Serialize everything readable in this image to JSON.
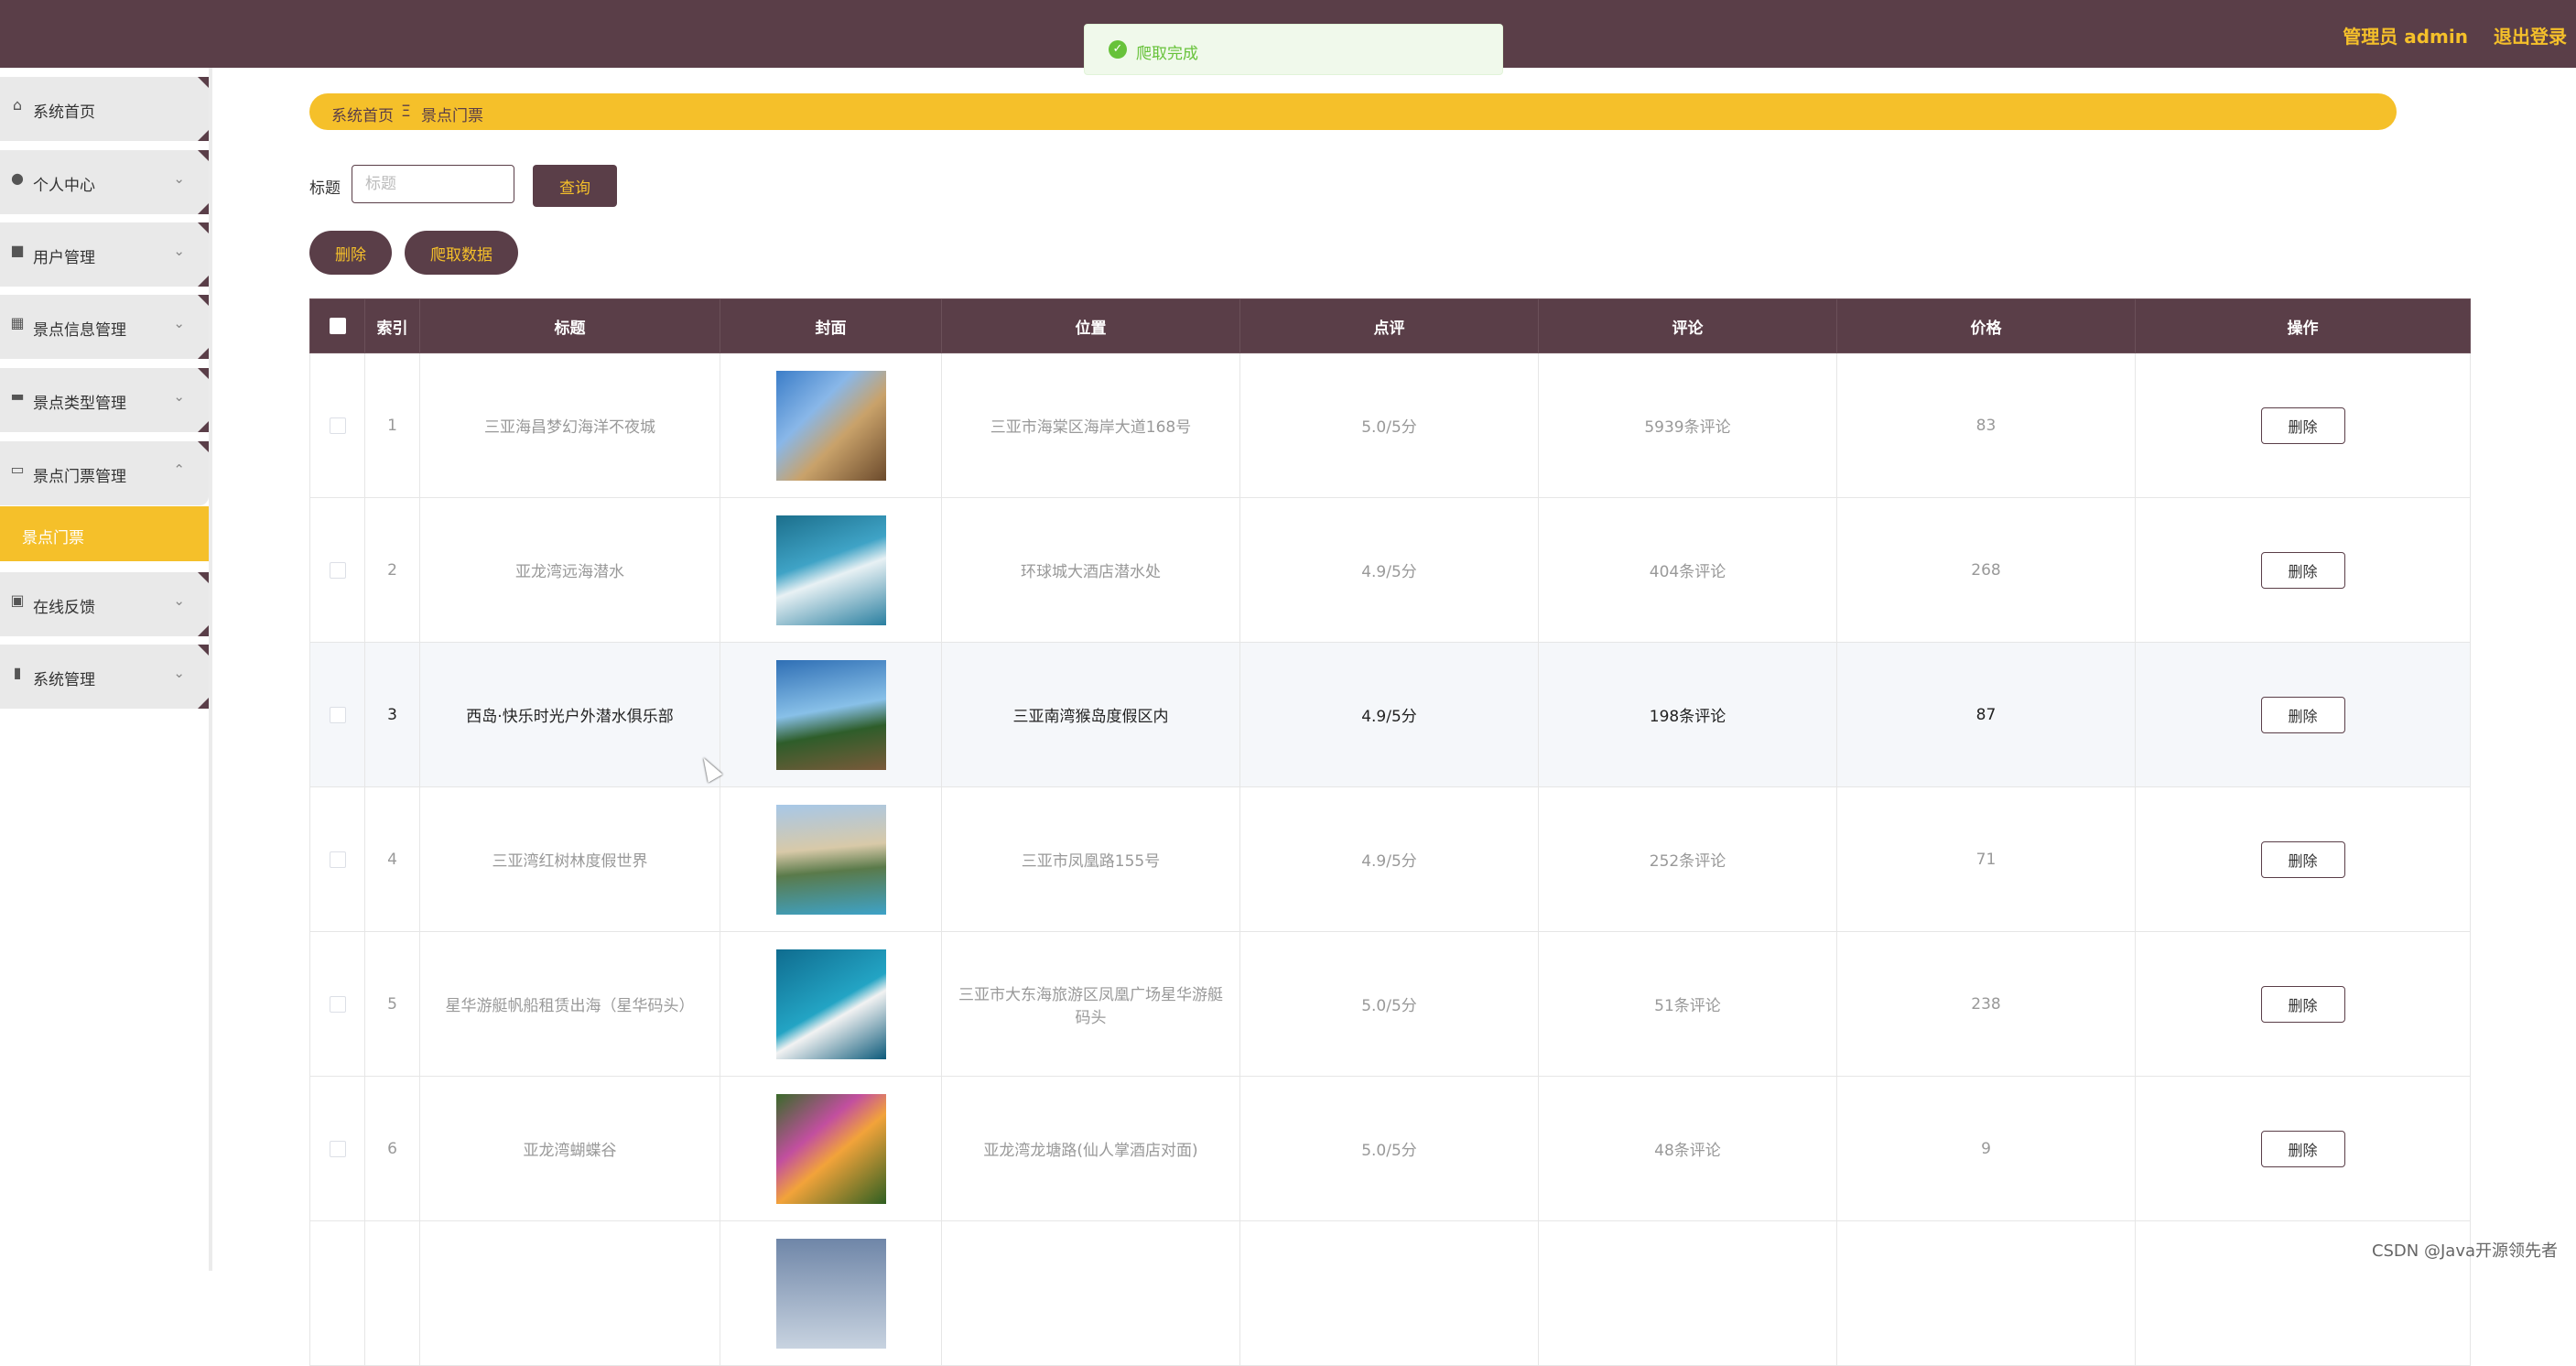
{
  "header": {
    "admin_label": "管理员 admin",
    "logout_label": "退出登录"
  },
  "toast": {
    "message": "爬取完成"
  },
  "sidebar": {
    "items": [
      {
        "label": "系统首页",
        "icon": "home-icon"
      },
      {
        "label": "个人中心",
        "icon": "user-icon"
      },
      {
        "label": "用户管理",
        "icon": "users-icon"
      },
      {
        "label": "景点信息管理",
        "icon": "grid-icon"
      },
      {
        "label": "景点类型管理",
        "icon": "briefcase-icon"
      },
      {
        "label": "景点门票管理",
        "icon": "ticket-icon"
      },
      {
        "label": "在线反馈",
        "icon": "clipboard-icon"
      },
      {
        "label": "系统管理",
        "icon": "bar-chart-icon"
      }
    ],
    "active_submenu": "景点门票"
  },
  "breadcrumb": {
    "home": "系统首页",
    "separator": "Ξ",
    "current": "景点门票"
  },
  "search": {
    "label": "标题",
    "placeholder": "标题",
    "query_button": "查询"
  },
  "actions": {
    "delete_label": "删除",
    "crawl_label": "爬取数据"
  },
  "table": {
    "headers": [
      "索引",
      "标题",
      "封面",
      "位置",
      "点评",
      "评论",
      "价格",
      "操作"
    ],
    "row_delete_label": "删除",
    "rows": [
      {
        "index": "1",
        "title": "三亚海昌梦幻海洋不夜城",
        "location": "三亚市海棠区海岸大道168号",
        "rating": "5.0/5分",
        "comments": "5939条评论",
        "price": "83"
      },
      {
        "index": "2",
        "title": "亚龙湾远海潜水",
        "location": "环球城大酒店潜水处",
        "rating": "4.9/5分",
        "comments": "404条评论",
        "price": "268"
      },
      {
        "index": "3",
        "title": "西岛·快乐时光户外潜水俱乐部",
        "location": "三亚南湾猴岛度假区内",
        "rating": "4.9/5分",
        "comments": "198条评论",
        "price": "87"
      },
      {
        "index": "4",
        "title": "三亚湾红树林度假世界",
        "location": "三亚市凤凰路155号",
        "rating": "4.9/5分",
        "comments": "252条评论",
        "price": "71"
      },
      {
        "index": "5",
        "title": "星华游艇帆船租赁出海（星华码头）",
        "location": "三亚市大东海旅游区凤凰广场星华游艇码头",
        "rating": "5.0/5分",
        "comments": "51条评论",
        "price": "238"
      },
      {
        "index": "6",
        "title": "亚龙湾蝴蝶谷",
        "location": "亚龙湾龙塘路(仙人掌酒店对面)",
        "rating": "5.0/5分",
        "comments": "48条评论",
        "price": "9"
      }
    ]
  },
  "watermark": "CSDN @Java开源领先者",
  "colors": {
    "primary": "#5a3e48",
    "accent": "#f5c02a",
    "success": "#67c23a"
  }
}
